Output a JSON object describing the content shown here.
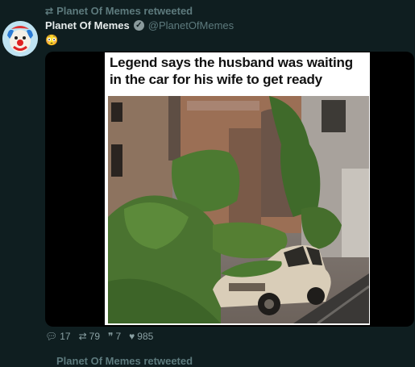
{
  "retweet": {
    "icon": "retweet-icon",
    "text": "Planet Of Memes retweeted"
  },
  "tweet": {
    "name": "Planet Of Memes",
    "verified_icon": "verified-icon",
    "handle": "@PlanetOfMemes",
    "emoji": "😳",
    "media_caption": "Legend says the husband was waiting in the car for his wife to get ready"
  },
  "actions": {
    "replies": "17",
    "retweets": "79",
    "quotes": "7",
    "likes": "985"
  },
  "next": {
    "text": "Planet Of Memes retweeted"
  },
  "colors": {
    "background": "#0f1e20",
    "muted": "#5d7a7d",
    "name": "#e7ecec"
  }
}
